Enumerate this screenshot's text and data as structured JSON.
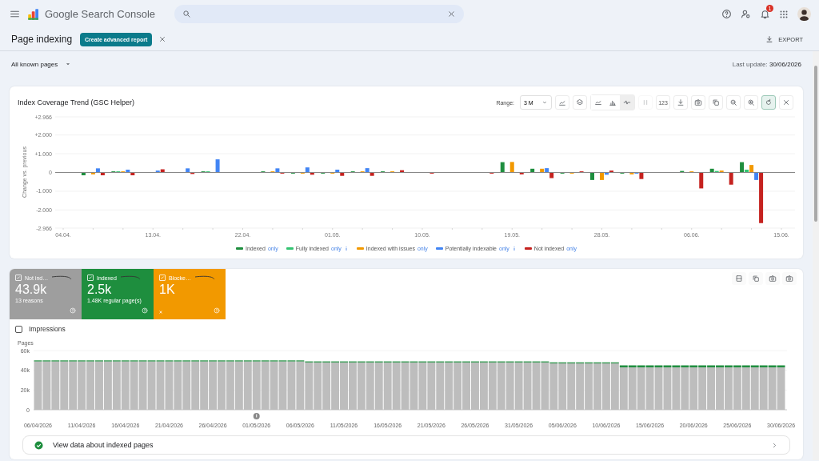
{
  "header": {
    "product": "Google Search Console",
    "notifications": "1"
  },
  "page": {
    "title": "Page indexing",
    "advanced_button": "Create advanced report",
    "export": "EXPORT"
  },
  "filter": {
    "value": "All known pages",
    "last_update": "Last update: **30/06/2026**"
  },
  "trend_card": {
    "toolbar": {
      "range_label": "Range:",
      "range_value": "3 M",
      "views": [
        {
          "selected": false
        },
        {
          "selected": false
        },
        {
          "selected": true
        }
      ],
      "split_disabled": true,
      "number_button": "123",
      "reset_pressed": true
    },
    "chart_data": {
      "type": "bar",
      "title": "Index Coverage Trend (GSC Helper)",
      "ylabel": "Change vs. previous",
      "grid": true,
      "categories": [
        "04.04.",
        null,
        null,
        "13.04.",
        null,
        null,
        "22.04.",
        null,
        null,
        "01.05.",
        null,
        null,
        "10.05.",
        null,
        null,
        "19.05.",
        null,
        null,
        "28.05.",
        null,
        null,
        "06.06.",
        null,
        null,
        "15.06."
      ],
      "series": [
        {
          "name": "Indexed",
          "color": "#1e8e3e",
          "values": [
            null,
            -0.15,
            0.06,
            null,
            null,
            0.06,
            null,
            0.06,
            -0.06,
            -0.06,
            0.06,
            0.06,
            null,
            null,
            null,
            0.55,
            0.2,
            -0.06,
            -0.4,
            -0.06,
            null,
            0.08,
            0.2,
            0.55,
            null
          ]
        },
        {
          "name": "Fully indexed",
          "color": "#34c472",
          "values": [
            null,
            null,
            0.06,
            null,
            null,
            0.06,
            null,
            null,
            null,
            null,
            null,
            null,
            null,
            null,
            null,
            null,
            null,
            null,
            null,
            null,
            null,
            null,
            0.08,
            0.15,
            null
          ]
        },
        {
          "name": "Indexed with issues",
          "color": "#f29900",
          "values": [
            null,
            -0.1,
            0.06,
            null,
            null,
            null,
            null,
            0.06,
            -0.06,
            -0.06,
            0.06,
            0.06,
            null,
            null,
            null,
            0.56,
            0.2,
            -0.06,
            -0.4,
            -0.1,
            null,
            0.06,
            0.1,
            0.4,
            null
          ]
        },
        {
          "name": "Potentially indexable",
          "color": "#4285f4",
          "values": [
            null,
            0.22,
            0.15,
            0.1,
            0.22,
            0.7,
            null,
            0.22,
            0.27,
            0.15,
            0.23,
            null,
            null,
            null,
            null,
            null,
            0.23,
            null,
            -0.12,
            -0.06,
            null,
            null,
            null,
            -0.4,
            null
          ]
        },
        {
          "name": "Not indexed",
          "color": "#c5221f",
          "values": [
            null,
            -0.15,
            -0.15,
            0.17,
            -0.08,
            null,
            null,
            -0.06,
            -0.12,
            -0.18,
            -0.18,
            0.12,
            -0.06,
            null,
            -0.06,
            -0.1,
            -0.3,
            0.06,
            0.1,
            -0.35,
            null,
            -0.85,
            -0.65,
            -2.7,
            null
          ]
        }
      ],
      "ylim": [
        -2.966,
        2.966
      ],
      "yticks": [
        {
          "value": 2.966,
          "label": "+2.966"
        },
        {
          "value": 2,
          "label": "+2.000"
        },
        {
          "value": 1,
          "label": "+1.000"
        },
        {
          "value": 0,
          "label": "0"
        },
        {
          "value": -1,
          "label": "-1.000"
        },
        {
          "value": -2,
          "label": "-2.000"
        },
        {
          "value": -2.966,
          "label": "-2.966"
        }
      ]
    },
    "legend": [
      {
        "link": "only",
        "info": false
      },
      {
        "link": "only",
        "info": true
      },
      {
        "link": "only",
        "info": false
      },
      {
        "link": "only",
        "info": true
      },
      {
        "link": "only",
        "info": false
      }
    ]
  },
  "metrics": [
    {
      "label": "Not ind…",
      "value": "43.9k",
      "detail": "13 reasons",
      "color": "#9e9e9e",
      "checked": true,
      "removable": false
    },
    {
      "label": "Indexed",
      "value": "2.5k",
      "detail": "1.48K regular page(s)",
      "color": "#1e8e3e",
      "checked": true,
      "removable": false
    },
    {
      "label": "Blocke…",
      "value": "1K",
      "color": "#f29900",
      "checked": true,
      "removable": true
    }
  ],
  "impressions": {
    "label": "Impressions",
    "checked": false
  },
  "pages_chart": {
    "chart_data": {
      "type": "bar",
      "stacked": true,
      "ylabel": "Pages",
      "ylim": [
        0,
        60000
      ],
      "grid": true,
      "yticks": [
        {
          "value": 0,
          "label": "0"
        },
        {
          "value": 20000,
          "label": "20k"
        },
        {
          "value": 40000,
          "label": "40k"
        },
        {
          "value": 60000,
          "label": "60k"
        }
      ],
      "categories": [
        "06/04/2026",
        null,
        null,
        null,
        null,
        "11/04/2026",
        null,
        null,
        null,
        null,
        "16/04/2026",
        null,
        null,
        null,
        null,
        "21/04/2026",
        null,
        null,
        null,
        null,
        "26/04/2026",
        null,
        null,
        null,
        null,
        "01/05/2026",
        null,
        null,
        null,
        null,
        "06/05/2026",
        null,
        null,
        null,
        null,
        "11/05/2026",
        null,
        null,
        null,
        null,
        "16/05/2026",
        null,
        null,
        null,
        null,
        "21/05/2026",
        null,
        null,
        null,
        null,
        "26/05/2026",
        null,
        null,
        null,
        null,
        "31/05/2026",
        null,
        null,
        null,
        null,
        "05/06/2026",
        null,
        null,
        null,
        null,
        "10/06/2026",
        null,
        null,
        null,
        null,
        "15/06/2026",
        null,
        null,
        null,
        null,
        "20/06/2026",
        null,
        null,
        null,
        null,
        "25/06/2026",
        null,
        null,
        null,
        null,
        "30/06/2026"
      ],
      "series": [
        {
          "color": "#bdbdbd",
          "values": [
            49000,
            49000,
            49000,
            49000,
            49000,
            49000,
            49000,
            49000,
            49000,
            49000,
            49000,
            49000,
            49000,
            49000,
            49000,
            49000,
            49000,
            49000,
            49000,
            49000,
            49000,
            49000,
            49000,
            49000,
            49000,
            49000,
            49000,
            49000,
            49000,
            49000,
            49000,
            48000,
            48000,
            48000,
            48000,
            48000,
            48000,
            48000,
            48000,
            48000,
            48000,
            48000,
            48000,
            48000,
            48000,
            48000,
            48000,
            48000,
            48000,
            48000,
            48000,
            48000,
            48000,
            48000,
            48000,
            48000,
            48000,
            48000,
            48000,
            47000,
            47000,
            47000,
            47000,
            47000,
            47000,
            47000,
            47000,
            43000,
            43000,
            43000,
            43000,
            43000,
            43000,
            43000,
            43000,
            43000,
            43000,
            43000,
            43000,
            43000,
            43000,
            43000,
            43000,
            43000,
            43000,
            43000
          ]
        },
        {
          "color": "#1e8e3e",
          "values": [
            1000,
            1000,
            1000,
            1000,
            1000,
            1000,
            1000,
            1000,
            1000,
            1000,
            1000,
            1000,
            1000,
            1000,
            1000,
            1000,
            1000,
            1000,
            1000,
            1000,
            1000,
            1000,
            1000,
            1000,
            1000,
            1000,
            1000,
            1000,
            1000,
            1000,
            1000,
            1000,
            1000,
            1000,
            1000,
            1000,
            1000,
            1000,
            1000,
            1000,
            1000,
            1000,
            1000,
            1000,
            1000,
            1000,
            1000,
            1000,
            1000,
            1000,
            1000,
            1000,
            1000,
            1000,
            1000,
            1000,
            1000,
            1000,
            1000,
            1000,
            1000,
            1000,
            1000,
            1000,
            1000,
            1000,
            1000,
            2000,
            2000,
            2000,
            2000,
            2000,
            2000,
            2000,
            2000,
            2000,
            2000,
            2000,
            2000,
            2000,
            2000,
            2000,
            2000,
            2000,
            2000,
            2000
          ]
        }
      ],
      "annotations": [
        {
          "x": "01/05/2026"
        }
      ]
    }
  },
  "details_link": {
    "label": "View data about indexed pages"
  }
}
